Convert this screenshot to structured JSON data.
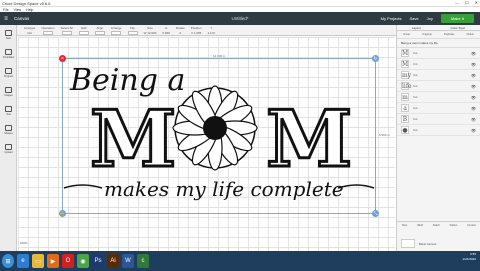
{
  "window": {
    "title": "Cricut Design Space  v5.6.6"
  },
  "menubar": {
    "items": [
      "File",
      "View",
      "Help"
    ]
  },
  "header": {
    "canvas_label": "Canvas",
    "doc_title": "Untitled*",
    "my_projects": "My Projects",
    "save": "Save",
    "machine": "Joy",
    "make_it": "Make It"
  },
  "toolbar": {
    "items": [
      {
        "label": "Linetype",
        "value": "Cut"
      },
      {
        "label": "Operation",
        "value": ""
      },
      {
        "label": "Select All",
        "value": ""
      },
      {
        "label": "Edit",
        "value": ""
      },
      {
        "label": "Align",
        "value": ""
      },
      {
        "label": "Arrange",
        "value": ""
      },
      {
        "label": "Flip",
        "value": ""
      },
      {
        "label": "Size",
        "value": "W 12.000"
      },
      {
        "label": "H",
        "value": "5.969"
      },
      {
        "label": "Rotate",
        "value": "0"
      },
      {
        "label": "Position",
        "value": "X 1.055"
      },
      {
        "label": "Y",
        "value": "1.172"
      }
    ]
  },
  "leftbar": {
    "items": [
      "New",
      "Templates",
      "Projects",
      "Images",
      "Text",
      "Shapes",
      "Upload"
    ]
  },
  "design": {
    "line1": "Being a",
    "big_left": "M",
    "big_right": "M",
    "line3": "makes my life complete",
    "width_label": "12.000 in",
    "height_label": "5.969 in"
  },
  "rightpanel": {
    "tabs": [
      "Layers",
      "Color Sync"
    ],
    "actions": [
      "Group",
      "Ungroup",
      "Duplicate",
      "Delete"
    ],
    "group_name": "Being a mom makes my life",
    "layers": [
      {
        "glyph": "M",
        "label": "Cut"
      },
      {
        "glyph": "M",
        "label": "Cut"
      },
      {
        "glyph": "my",
        "label": "Cut"
      },
      {
        "glyph": "life",
        "label": "Cut"
      },
      {
        "glyph": "m",
        "label": "Cut"
      },
      {
        "glyph": "a",
        "label": "Cut"
      },
      {
        "glyph": "B",
        "label": "Cut"
      },
      {
        "glyph": "●",
        "label": "Cut"
      }
    ],
    "bottom_actions": [
      "Slice",
      "Weld",
      "Attach",
      "Flatten",
      "Contour"
    ],
    "blank_canvas": "Blank Canvas"
  },
  "zoom": {
    "value": "100%"
  },
  "taskbar": {
    "time": "9:55",
    "date": "2/24/2020"
  }
}
